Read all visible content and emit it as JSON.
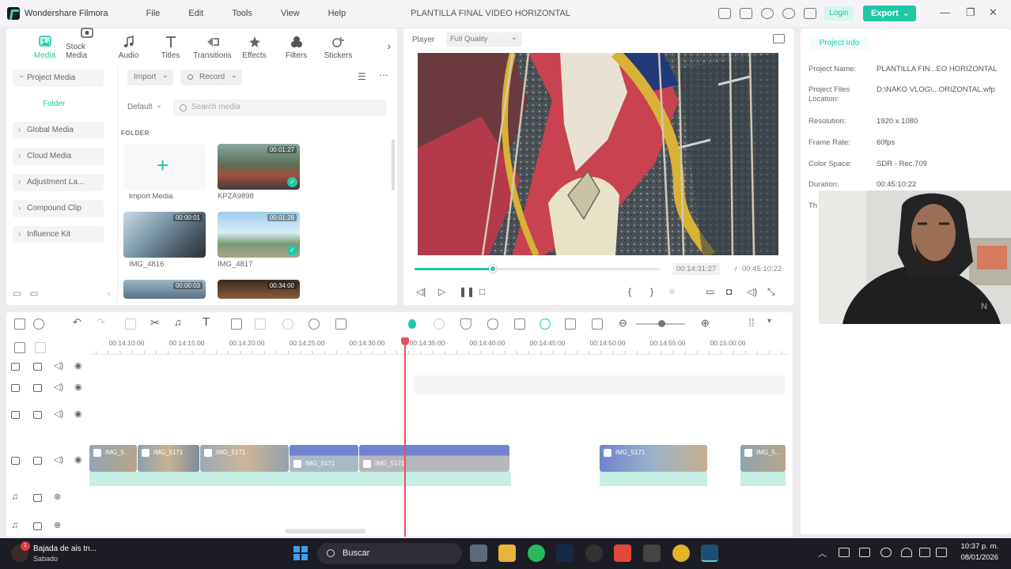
{
  "titlebar": {
    "app_name": "Wondershare Filmora",
    "menu": [
      "File",
      "Edit",
      "Tools",
      "View",
      "Help"
    ],
    "doc_title": "PLANTILLA FINAL VIDEO HORIZONTAL",
    "login_label": "Login",
    "export_label": "Export",
    "accent": "#1ec8a5"
  },
  "media_tabs": [
    {
      "label": "Media",
      "icon": "media-icon",
      "active": true
    },
    {
      "label": "Stock Media",
      "icon": "stock-media-icon"
    },
    {
      "label": "Audio",
      "icon": "music-note-icon"
    },
    {
      "label": "Titles",
      "icon": "text-t-icon"
    },
    {
      "label": "Transitions",
      "icon": "transitions-icon"
    },
    {
      "label": "Effects",
      "icon": "effects-icon"
    },
    {
      "label": "Filters",
      "icon": "filters-icon"
    },
    {
      "label": "Stickers",
      "icon": "stickers-icon"
    }
  ],
  "sidebar": {
    "items": [
      {
        "label": "Project Media",
        "expanded": true
      },
      {
        "label": "Folder",
        "sub": true
      },
      {
        "label": "Global Media"
      },
      {
        "label": "Cloud Media"
      },
      {
        "label": "Adjustment La..."
      },
      {
        "label": "Compound Clip"
      },
      {
        "label": "Influence Kit"
      }
    ]
  },
  "media": {
    "import_label": "Import",
    "record_label": "Record",
    "sort_label": "Default",
    "search_placeholder": "Search media",
    "folder_heading": "FOLDER",
    "import_tile_label": "Import Media",
    "items": [
      {
        "name": "KPZA9898",
        "duration": "00:01:27",
        "checked": true
      },
      {
        "name": "IMG_4816",
        "duration": "00:00:01",
        "checked": false
      },
      {
        "name": "IMG_4817",
        "duration": "00:01:28",
        "checked": true
      },
      {
        "name": "",
        "duration": "00:00:03",
        "checked": false
      },
      {
        "name": "",
        "duration": "00:34:00",
        "checked": false
      }
    ]
  },
  "player": {
    "label": "Player",
    "quality": "Full Quality",
    "current_time": "00:14:31:27",
    "separator": "/",
    "total_time": "00:45:10:22",
    "progress": 0.32
  },
  "project_info": {
    "tab": "Project Info",
    "rows": [
      {
        "key": "Project Name:",
        "value": "PLANTILLA FIN...EO HORIZONTAL"
      },
      {
        "key": "Project Files Location:",
        "value": "D:\\NAKO VLOG\\...ORIZONTAL.wfp"
      },
      {
        "key": "Resolution:",
        "value": "1920 x 1080"
      },
      {
        "key": "Frame Rate:",
        "value": "60fps"
      },
      {
        "key": "Color Space:",
        "value": "SDR - Rec.709"
      },
      {
        "key": "Duration:",
        "value": "00:45:10:22"
      },
      {
        "key": "Th",
        "value": ""
      }
    ]
  },
  "timeline": {
    "ruler": [
      "00:14:10:00",
      "00:14:15:00",
      "00:14:20:00",
      "00:14:25:00",
      "00:14:30:00",
      "00:14:35:00",
      "00:14:40:00",
      "00:14:45:00",
      "00:14:50:00",
      "00:14:55:00",
      "00:15:00:00"
    ],
    "clips": [
      "IMG_5...",
      "IMG_5171",
      "IMG_5171",
      "IMG_5171",
      "IMG_5171",
      "IMG_5171",
      "IMG_5..."
    ]
  },
  "taskbar": {
    "news_title": "Bajada de ais tn...",
    "news_sub": "Sabado",
    "news_badge": "1",
    "search_label": "Buscar",
    "time": "10:37 p. m.",
    "date": "08/01/2026"
  }
}
